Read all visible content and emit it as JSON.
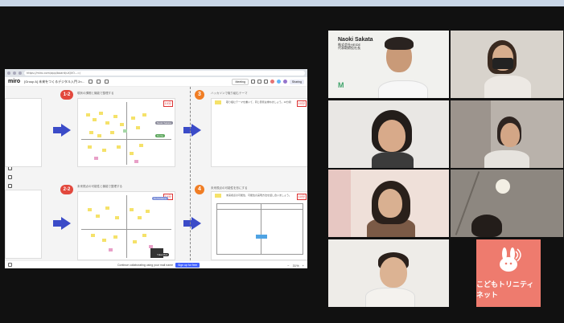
{
  "browser": {
    "url": "https://miro.com/app/board/uXjVO...=/"
  },
  "miro": {
    "logo": "miro",
    "board_name": "[Group A] 未来をつくるデジタル入門 2n...",
    "meeting_label": "Meeting",
    "share_label": "Sharing"
  },
  "board": {
    "badge_1_2": "1-2",
    "badge_2_2": "2-2",
    "badge_3": "3",
    "badge_4": "4",
    "frame_1_title": "現状の課題と機能で整理する",
    "frame_2_title": "未来視点の可能性と機能で整理する",
    "frame_3_title": "ハッカソンで取り組むテーマ",
    "frame_4_title": "未来視点の可能性を形にする",
    "tag_10min": "10分",
    "frame_3_text": "取り組むテーマを書いて、同じ意見は重ねましょう。10分間",
    "frame_4_text": "未来視点の可能性、可能性の実現方法を話し合いましょう。",
    "pill_1": "Naoki Sakata",
    "pill_2": "Ko Ita",
    "pill_3": "Ko Kodoma",
    "pill_4": "Yuka Mori"
  },
  "footer": {
    "collab_text": "Continue collaborating using your mail name",
    "signup_label": "Sign up for free",
    "zoom_level": "31%"
  },
  "participants": {
    "main_name": "Naoki Sakata",
    "main_org": "株式会社HEIDE",
    "main_role": "代表取締役社長",
    "org_logo_mark": "M",
    "kodomo_name": "こどもトリニティネット"
  },
  "colors": {
    "accent_active": "#b9d84a",
    "badge_red": "#e2483d",
    "badge_orange": "#f07d24",
    "arrow_blue": "#3b4bc8",
    "kodomo_bg": "#ee7b6e"
  }
}
